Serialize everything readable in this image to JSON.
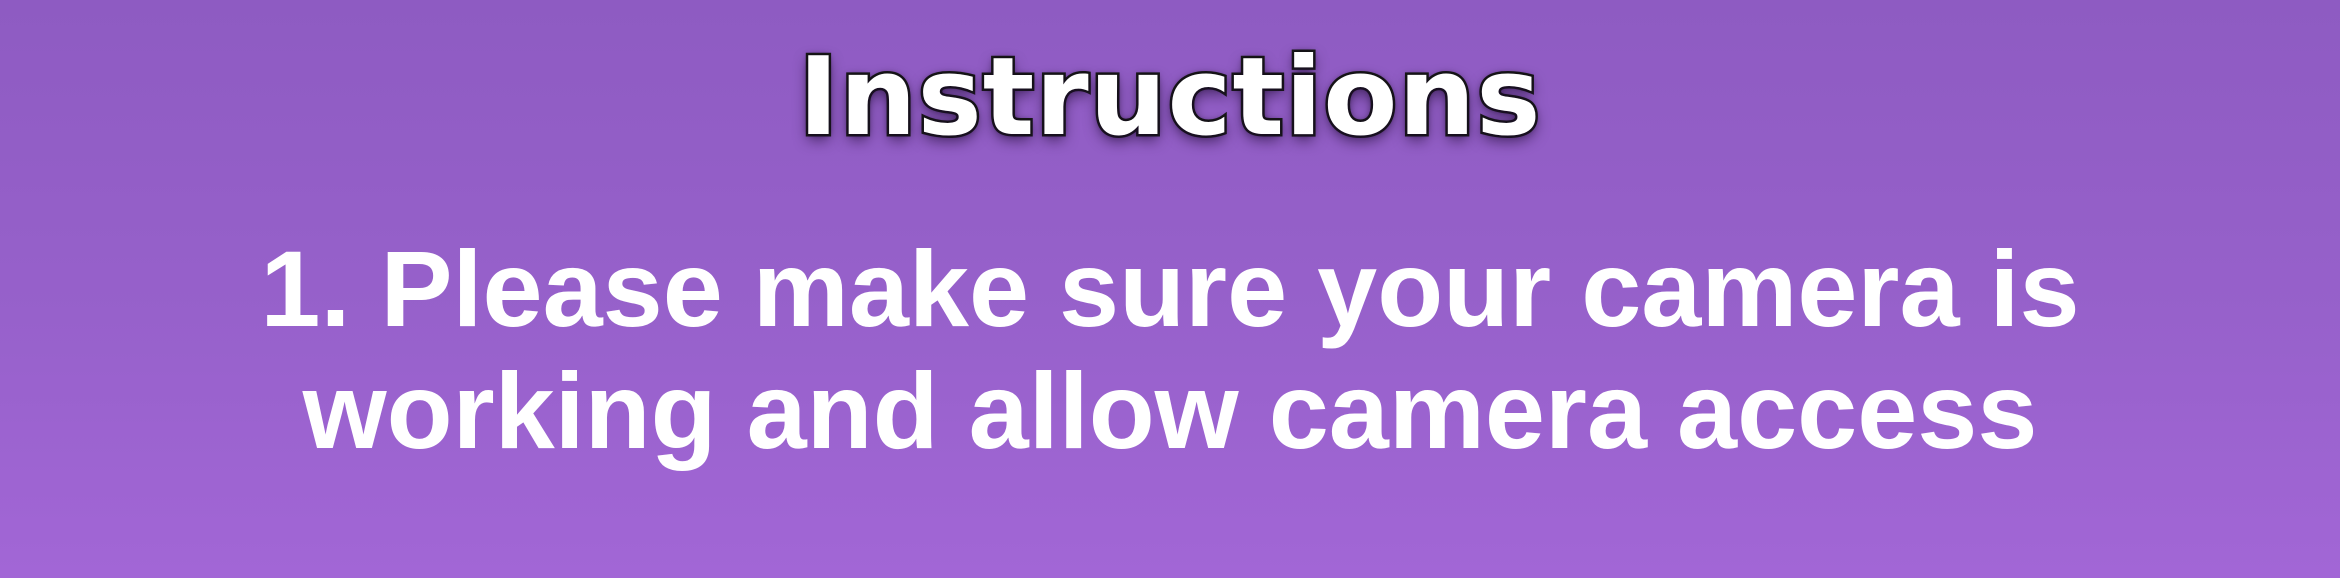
{
  "instructions": {
    "title": "Instructions",
    "lines": [
      "1. Please make sure your camera is",
      "working and allow camera access"
    ]
  },
  "colors": {
    "background_top": "#8e5bc2",
    "background_bottom": "#a266d6",
    "text": "#ffffff",
    "title_outline": "#1a1a1a"
  }
}
